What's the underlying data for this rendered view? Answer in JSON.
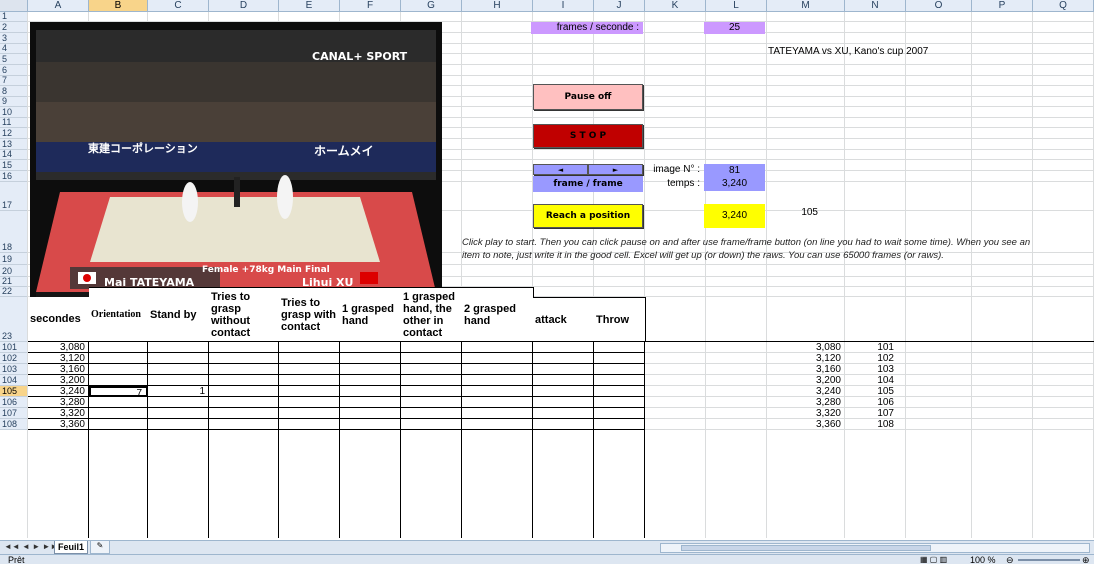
{
  "columns": [
    "A",
    "B",
    "C",
    "D",
    "E",
    "F",
    "G",
    "H",
    "I",
    "J",
    "K",
    "L",
    "M",
    "N",
    "O",
    "P",
    "Q"
  ],
  "selected_column": "B",
  "rows": [
    "1",
    "2",
    "3",
    "4",
    "5",
    "6",
    "7",
    "8",
    "9",
    "10",
    "11",
    "12",
    "13",
    "14",
    "15",
    "16",
    "17",
    "18",
    "19",
    "20",
    "21",
    "22",
    "23",
    "101",
    "102",
    "103",
    "104",
    "105",
    "106",
    "107",
    "108"
  ],
  "selected_row": "105",
  "video": {
    "channel": "CANAL+ SPORT",
    "caption": "Female +78kg Main Final",
    "player_left": "Mai TATEYAMA",
    "player_right": "Lihui XU",
    "sponsor": "東建コーポレーション",
    "banner": "ホームメイ"
  },
  "labels": {
    "frames_per_second": "frames / seconde :",
    "fps_value": "25",
    "match_title": "TATEYAMA vs XU, Kano's cup 2007",
    "image_label": "image N° :",
    "image_value": "81",
    "time_label": "temps :",
    "time_value": "3,240",
    "reach_value": "3,240",
    "reach_frame": "105",
    "instructions": "Click play to start. Then you can click pause on and after use frame/frame button (on line you had to wait some time). When you see an item to note, just write it in the good cell. Excel will get up (or down) the raws. You can use 65000 frames (or raws)."
  },
  "buttons": {
    "pause": "Pause off",
    "stop": "S T O P",
    "prev": "◄",
    "next": "►",
    "frame_by_frame": "frame / frame",
    "reach": "Reach a position"
  },
  "colors": {
    "pause_bg": "#ffc0c0",
    "stop_bg": "#c00000",
    "nav_bg": "#9999ff",
    "reach_bg": "#ffff00",
    "label_bg": "#cc99ff"
  },
  "table": {
    "headers": [
      "secondes",
      "Orientation",
      "Stand by",
      "Tries to grasp without contact",
      "Tries to grasp with contact",
      "1 grasped hand",
      "1 grasped hand, the other in contact",
      "2 grasped hand",
      "attack",
      "Throw"
    ],
    "rows": [
      {
        "row": "101",
        "sec": "3,080",
        "b": "",
        "c": "",
        "m": "3,080",
        "n": "101"
      },
      {
        "row": "102",
        "sec": "3,120",
        "b": "",
        "c": "",
        "m": "3,120",
        "n": "102"
      },
      {
        "row": "103",
        "sec": "3,160",
        "b": "",
        "c": "",
        "m": "3,160",
        "n": "103"
      },
      {
        "row": "104",
        "sec": "3,200",
        "b": "",
        "c": "",
        "m": "3,200",
        "n": "104"
      },
      {
        "row": "105",
        "sec": "3,240",
        "b": "7",
        "c": "1",
        "m": "3,240",
        "n": "105"
      },
      {
        "row": "106",
        "sec": "3,280",
        "b": "",
        "c": "",
        "m": "3,280",
        "n": "106"
      },
      {
        "row": "107",
        "sec": "3,320",
        "b": "",
        "c": "",
        "m": "3,320",
        "n": "107"
      },
      {
        "row": "108",
        "sec": "3,360",
        "b": "",
        "c": "",
        "m": "3,360",
        "n": "108"
      }
    ]
  },
  "sheet_tab": "Feuil1",
  "status": "Prêt",
  "zoom": "100 %"
}
